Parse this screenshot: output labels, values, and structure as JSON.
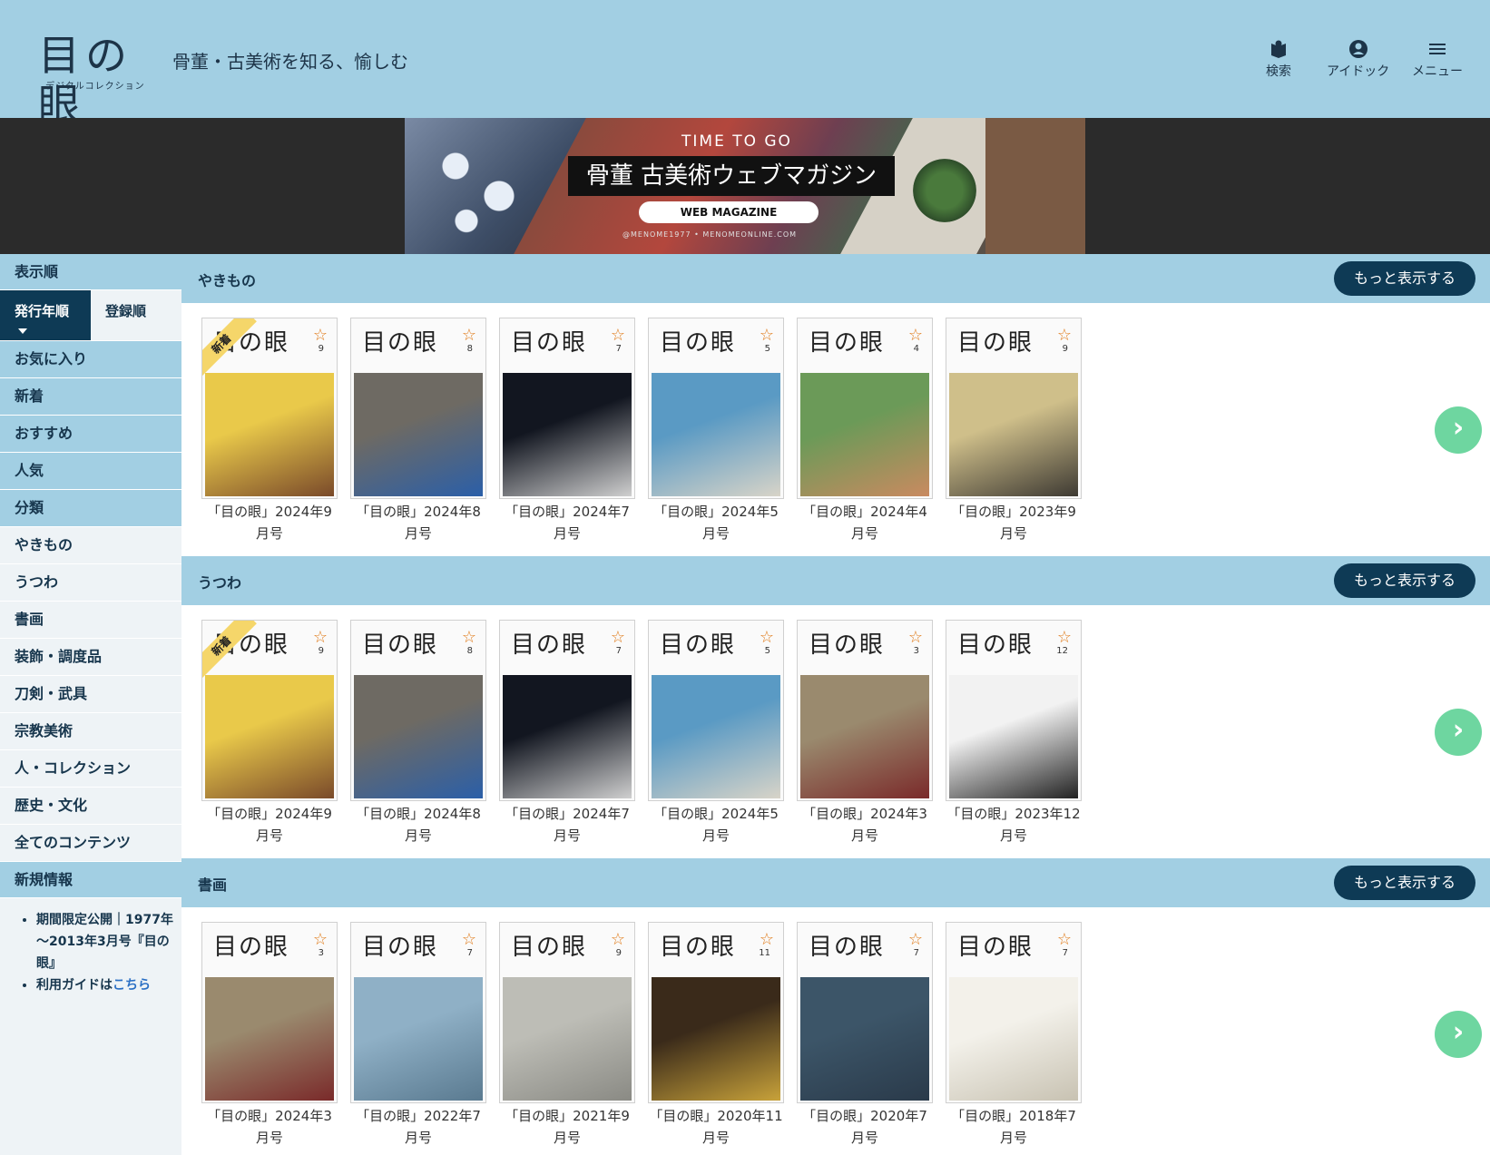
{
  "header": {
    "logo_text": "目の眼",
    "logo_sub": "デジタルコレクション",
    "tagline": "骨董・古美術を知る、愉しむ",
    "nav": [
      {
        "label": "検索",
        "icon": "book-search-icon"
      },
      {
        "label": "アイドック",
        "icon": "user-circle-icon"
      },
      {
        "label": "メニュー",
        "icon": "hamburger-icon"
      }
    ]
  },
  "banner": {
    "line1": "TIME TO GO",
    "line2": "骨董 古美術ウェブマガジン",
    "button": "WEB MAGAZINE",
    "footer": "@MENOME1977   •   MENOMEONLINE.COM"
  },
  "sidebar": {
    "sort_header": "表示順",
    "sort_active": "発行年順",
    "sort_other": "登録順",
    "items": [
      {
        "label": "お気に入り",
        "style": "blue"
      },
      {
        "label": "新着",
        "style": "blue"
      },
      {
        "label": "おすすめ",
        "style": "blue"
      },
      {
        "label": "人気",
        "style": "blue"
      },
      {
        "label": "分類",
        "style": "blue"
      },
      {
        "label": "やきもの",
        "style": "gray"
      },
      {
        "label": "うつわ",
        "style": "gray"
      },
      {
        "label": "書画",
        "style": "gray"
      },
      {
        "label": "装飾・調度品",
        "style": "gray"
      },
      {
        "label": "刀剣・武具",
        "style": "gray"
      },
      {
        "label": "宗教美術",
        "style": "gray"
      },
      {
        "label": "人・コレクション",
        "style": "gray"
      },
      {
        "label": "歴史・文化",
        "style": "gray"
      },
      {
        "label": "全てのコンテンツ",
        "style": "gray"
      }
    ],
    "news_header": "新規情報",
    "news": [
      {
        "text": "期間限定公開｜1977年～2013年3月号『目の眼』"
      },
      {
        "text": "利用ガイドは",
        "link": "こちら"
      }
    ]
  },
  "sections": [
    {
      "title": "やきもの",
      "more": "もっと表示する",
      "items": [
        {
          "caption": "「目の眼」2024年9月号",
          "num": "9",
          "badge": "新着",
          "colors": [
            "#e9c94a",
            "#7a4a2a"
          ]
        },
        {
          "caption": "「目の眼」2024年8月号",
          "num": "8",
          "colors": [
            "#6e6a63",
            "#2b5fa8"
          ]
        },
        {
          "caption": "「目の眼」2024年7月号",
          "num": "7",
          "colors": [
            "#121620",
            "#cfcfcf"
          ]
        },
        {
          "caption": "「目の眼」2024年5月号",
          "num": "5",
          "colors": [
            "#5a9ac4",
            "#d8d4c8"
          ]
        },
        {
          "caption": "「目の眼」2024年4月号",
          "num": "4",
          "colors": [
            "#6b9a58",
            "#c98a60"
          ]
        },
        {
          "caption": "「目の眼」2023年9月号",
          "num": "9",
          "colors": [
            "#cfbf8a",
            "#3e3a33"
          ]
        }
      ]
    },
    {
      "title": "うつわ",
      "more": "もっと表示する",
      "items": [
        {
          "caption": "「目の眼」2024年9月号",
          "num": "9",
          "badge": "新着",
          "colors": [
            "#e9c94a",
            "#7a4a2a"
          ]
        },
        {
          "caption": "「目の眼」2024年8月号",
          "num": "8",
          "colors": [
            "#6e6a63",
            "#2b5fa8"
          ]
        },
        {
          "caption": "「目の眼」2024年7月号",
          "num": "7",
          "colors": [
            "#121620",
            "#cfcfcf"
          ]
        },
        {
          "caption": "「目の眼」2024年5月号",
          "num": "5",
          "colors": [
            "#5a9ac4",
            "#d8d4c8"
          ]
        },
        {
          "caption": "「目の眼」2024年3月号",
          "num": "3",
          "colors": [
            "#9a8a6e",
            "#7a2a2a"
          ]
        },
        {
          "caption": "「目の眼」2023年12月号",
          "num": "12",
          "colors": [
            "#f2f2f2",
            "#222222"
          ]
        }
      ]
    },
    {
      "title": "書画",
      "more": "もっと表示する",
      "items": [
        {
          "caption": "「目の眼」2024年3月号",
          "num": "3",
          "colors": [
            "#9a8a6e",
            "#7a2a2a"
          ]
        },
        {
          "caption": "「目の眼」2022年7月号",
          "num": "7",
          "colors": [
            "#8fb0c6",
            "#5a7a90"
          ]
        },
        {
          "caption": "「目の眼」2021年9月号",
          "num": "9",
          "colors": [
            "#bdbdb6",
            "#8a8a84"
          ]
        },
        {
          "caption": "「目の眼」2020年11月号",
          "num": "11",
          "colors": [
            "#3a2a1a",
            "#c8a23a"
          ]
        },
        {
          "caption": "「目の眼」2020年7月号",
          "num": "7",
          "colors": [
            "#3c5568",
            "#2a3a4a"
          ]
        },
        {
          "caption": "「目の眼」2018年7月号",
          "num": "7",
          "colors": [
            "#f3f1ea",
            "#c8c2b2"
          ]
        }
      ]
    }
  ]
}
